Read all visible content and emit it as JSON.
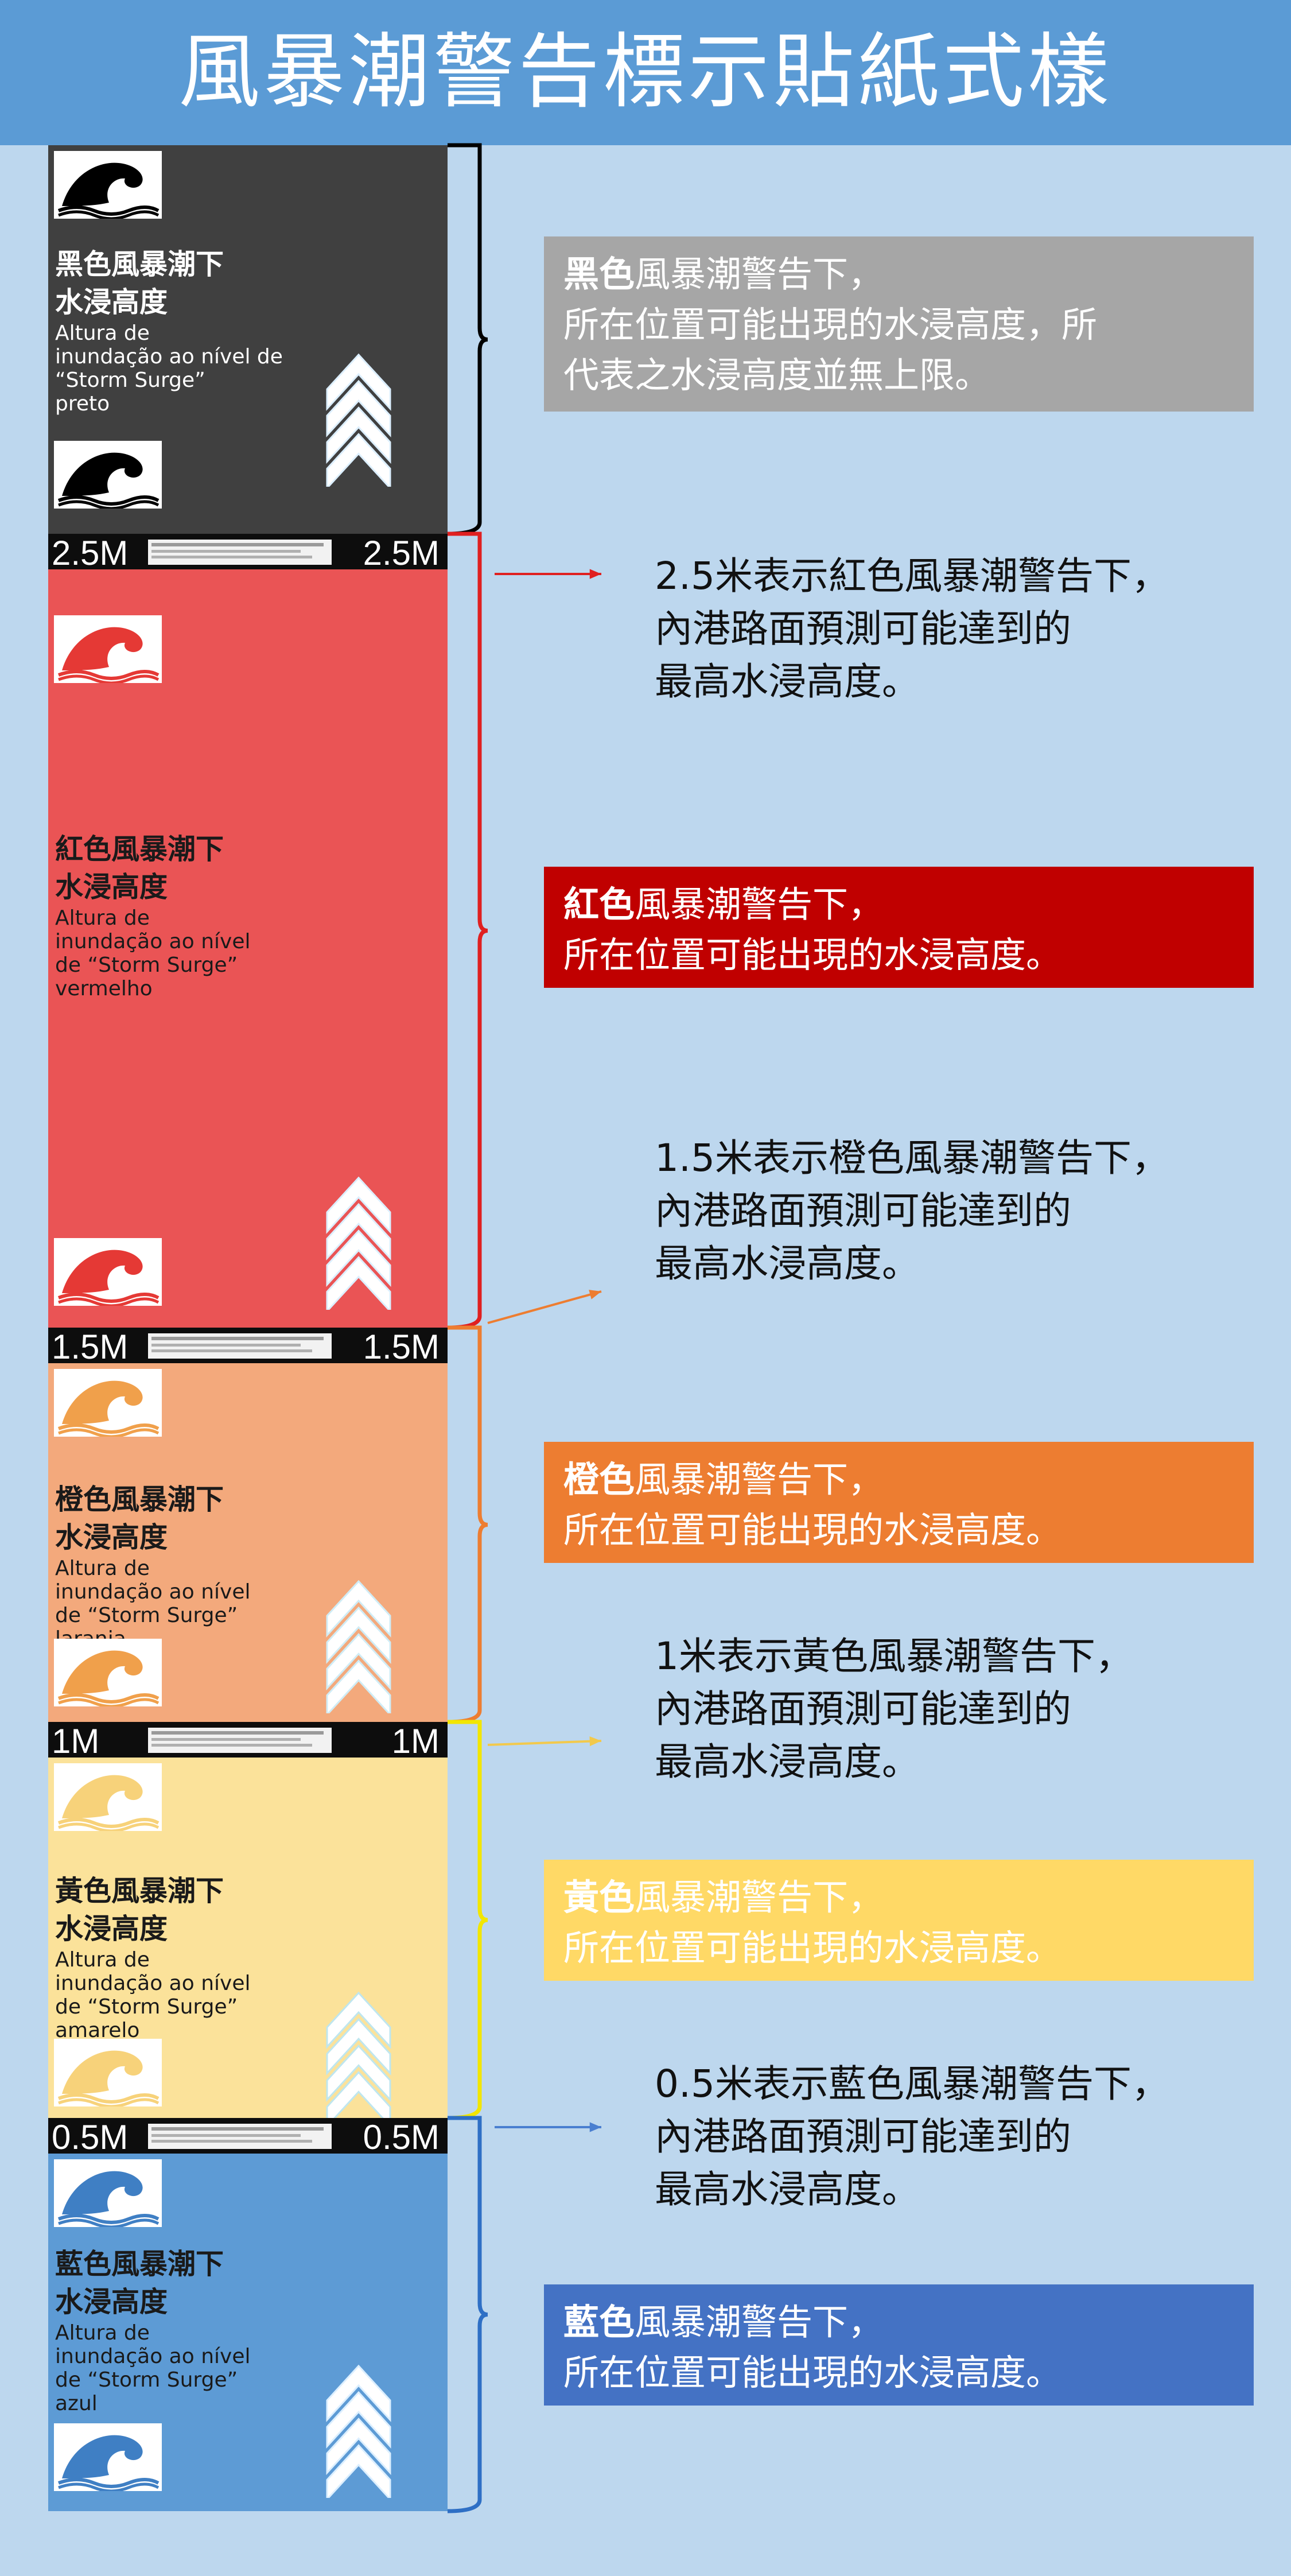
{
  "title": "風暴潮警告標示貼紙式樣",
  "sections": [
    {
      "key": "black",
      "color": "#404040",
      "label_zh": "黑色風暴潮下\n水浸高度",
      "label_pt": "Altura de\ninundação ao nível de\n“Storm Surge”\n preto"
    },
    {
      "key": "red",
      "color": "#ea5455",
      "label_zh": "紅色風暴潮下\n水浸高度",
      "label_pt": "Altura de\ninundação ao nível\nde “Storm Surge”\nvermelho"
    },
    {
      "key": "orange",
      "color": "#f3a97c",
      "label_zh": "橙色風暴潮下\n水浸高度",
      "label_pt": "Altura de\ninundação ao nível\nde “Storm Surge”\nlaranja"
    },
    {
      "key": "yellow",
      "color": "#fbe29a",
      "label_zh": "黃色風暴潮下\n水浸高度",
      "label_pt": "Altura de\ninundação ao nível\nde “Storm Surge”\namarelo"
    },
    {
      "key": "blue",
      "color": "#5d9bd5",
      "label_zh": "藍色風暴潮下\n水浸高度",
      "label_pt": "Altura de\ninundação ao nível\nde “Storm Surge”\nazul"
    }
  ],
  "bars": [
    {
      "left": "2.5M",
      "right": "2.5M"
    },
    {
      "left": "1.5M",
      "right": "1.5M"
    },
    {
      "left": "1M",
      "right": "1M"
    },
    {
      "left": "0.5M",
      "right": "0.5M"
    }
  ],
  "boxes": [
    {
      "bold": "黑色",
      "rest": "風暴潮警告下，\n所在位置可能出現的水浸高度，所\n代表之水浸高度並無上限。",
      "bg": "#a6a6a6"
    },
    {
      "bold": "紅色",
      "rest": "風暴潮警告下，\n所在位置可能出現的水浸高度。",
      "bg": "#c00000"
    },
    {
      "bold": "橙色",
      "rest": "風暴潮警告下，\n所在位置可能出現的水浸高度。",
      "bg": "#ed7d31"
    },
    {
      "bold": "黃色",
      "rest": "風暴潮警告下，\n所在位置可能出現的水浸高度。",
      "bg": "#ffd966"
    },
    {
      "bold": "藍色",
      "rest": "風暴潮警告下，\n所在位置可能出現的水浸高度。",
      "bg": "#4472c4"
    }
  ],
  "notes": [
    "2.5米表示紅色風暴潮警告下，\n內港路面預測可能達到的\n最高水浸高度。",
    "1.5米表示橙色風暴潮警告下，\n內港路面預測可能達到的\n最高水浸高度。",
    "1米表示黃色風暴潮警告下，\n內港路面預測可能達到的\n最高水浸高度。",
    "0.5米表示藍色風暴潮警告下，\n內港路面預測可能達到的\n最高水浸高度。"
  ],
  "colors": {
    "background": "#bdd7ee",
    "header": "#5b9bd5",
    "bar": "#0d0d0d"
  },
  "icons": [
    "wave-icon",
    "chevron-up-icon",
    "bracket",
    "arrow-icon"
  ]
}
